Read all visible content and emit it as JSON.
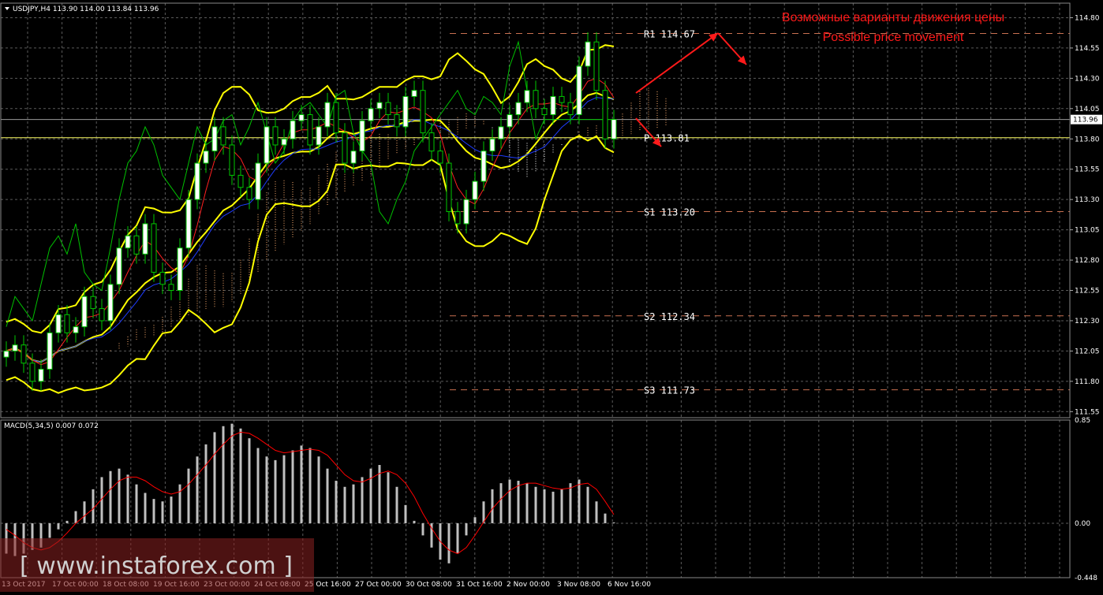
{
  "header": {
    "symbol_line": "USDJPY,H4  113.90 114.00 113.84 113.96"
  },
  "annotation": {
    "line1": "Возможные варианты движения цены",
    "line2": "Possible price movement"
  },
  "watermark": "[ www.instaforex.com ]",
  "colors": {
    "background": "#000000",
    "grid": "#5a5a5a",
    "bull_candle": "#ffffff",
    "bear_candle": "#000000",
    "wick": "#00c800",
    "bollinger": "#ffff00",
    "tenkan": "#ff2020",
    "kijun": "#1e3cff",
    "chikou": "#00c000",
    "cloud_a": "#ffb070",
    "cloud_b": "#ffffff",
    "macd_hist": "#c0c0c0",
    "macd_signal": "#ff0000",
    "annotation": "#ff1a1a",
    "pivot_line": "#ffff66",
    "level_line": "#c87050"
  },
  "chart_data": [
    {
      "type": "candlestick",
      "title": "USDJPY,H4",
      "ohlc_last": {
        "open": 113.9,
        "high": 114.0,
        "low": 113.84,
        "close": 113.96
      },
      "ylim": [
        111.5,
        114.92
      ],
      "y_ticks": [
        "114.80",
        "114.55",
        "114.30",
        "114.05",
        "113.80",
        "113.55",
        "113.30",
        "113.05",
        "112.80",
        "112.55",
        "112.30",
        "112.05",
        "111.80",
        "111.55"
      ],
      "x_ticks": [
        "13 Oct 2017",
        "17 Oct 00:00",
        "18 Oct 08:00",
        "19 Oct 16:00",
        "23 Oct 00:00",
        "24 Oct 08:00",
        "25 Oct 16:00",
        "27 Oct 00:00",
        "30 Oct 08:00",
        "31 Oct 16:00",
        "2 Nov 00:00",
        "3 Nov 08:00",
        "6 Nov 16:00"
      ],
      "current_price": 113.96,
      "close_series": [
        112.05,
        112.1,
        111.95,
        111.8,
        111.9,
        112.2,
        112.35,
        112.2,
        112.25,
        112.5,
        112.4,
        112.3,
        112.6,
        112.9,
        113.0,
        112.85,
        113.1,
        112.7,
        112.6,
        112.55,
        112.9,
        113.3,
        113.6,
        113.7,
        113.9,
        113.75,
        113.5,
        113.4,
        113.3,
        113.6,
        113.9,
        113.75,
        113.8,
        113.95,
        114.0,
        113.75,
        113.9,
        114.1,
        113.85,
        113.6,
        113.7,
        113.95,
        114.05,
        114.1,
        114.0,
        113.9,
        114.15,
        114.2,
        113.85,
        113.7,
        113.6,
        113.2,
        113.1,
        113.3,
        113.45,
        113.7,
        113.8,
        113.9,
        114.0,
        114.1,
        114.2,
        114.05,
        114.0,
        114.15,
        114.1,
        114.0,
        114.4,
        114.6,
        114.2,
        113.8,
        113.96
      ],
      "pivot_levels": [
        {
          "label": "R1 114.67",
          "value": 114.67
        },
        {
          "label": "P  113.81",
          "value": 113.81
        },
        {
          "label": "S1 113.20",
          "value": 113.2
        },
        {
          "label": "S2 112.34",
          "value": 112.34
        },
        {
          "label": "S3 111.73",
          "value": 111.73
        }
      ],
      "indicators": [
        "Bollinger Bands",
        "Ichimoku Kinko Hyo"
      ]
    },
    {
      "type": "bar",
      "title": "MACD(5,34,5) 0.007 0.072",
      "ylim": [
        -0.448,
        0.85
      ],
      "y_ticks": [
        "0.85",
        "0.00",
        "-0.448"
      ],
      "main_value": 0.007,
      "signal_value": 0.072,
      "histogram": [
        -0.25,
        -0.27,
        -0.25,
        -0.22,
        -0.2,
        -0.12,
        -0.05,
        0.02,
        0.1,
        0.18,
        0.28,
        0.38,
        0.43,
        0.45,
        0.4,
        0.32,
        0.25,
        0.2,
        0.18,
        0.22,
        0.32,
        0.45,
        0.55,
        0.65,
        0.75,
        0.8,
        0.82,
        0.78,
        0.7,
        0.62,
        0.55,
        0.52,
        0.56,
        0.6,
        0.64,
        0.62,
        0.55,
        0.45,
        0.35,
        0.3,
        0.32,
        0.38,
        0.45,
        0.48,
        0.42,
        0.3,
        0.15,
        0.02,
        -0.1,
        -0.2,
        -0.3,
        -0.33,
        -0.25,
        -0.1,
        0.05,
        0.18,
        0.28,
        0.33,
        0.36,
        0.35,
        0.33,
        0.3,
        0.28,
        0.26,
        0.28,
        0.33,
        0.36,
        0.3,
        0.18,
        0.08,
        0.007
      ],
      "signal": [
        -0.05,
        -0.1,
        -0.16,
        -0.2,
        -0.22,
        -0.2,
        -0.15,
        -0.08,
        0.0,
        0.06,
        0.12,
        0.2,
        0.28,
        0.35,
        0.38,
        0.38,
        0.35,
        0.3,
        0.26,
        0.24,
        0.26,
        0.32,
        0.4,
        0.48,
        0.57,
        0.65,
        0.72,
        0.75,
        0.74,
        0.7,
        0.65,
        0.6,
        0.58,
        0.59,
        0.6,
        0.61,
        0.6,
        0.56,
        0.48,
        0.4,
        0.35,
        0.34,
        0.37,
        0.41,
        0.43,
        0.4,
        0.33,
        0.22,
        0.08,
        -0.04,
        -0.15,
        -0.22,
        -0.25,
        -0.2,
        -0.1,
        0.01,
        0.12,
        0.2,
        0.27,
        0.31,
        0.33,
        0.33,
        0.31,
        0.29,
        0.28,
        0.29,
        0.32,
        0.33,
        0.28,
        0.18,
        0.072
      ]
    }
  ]
}
